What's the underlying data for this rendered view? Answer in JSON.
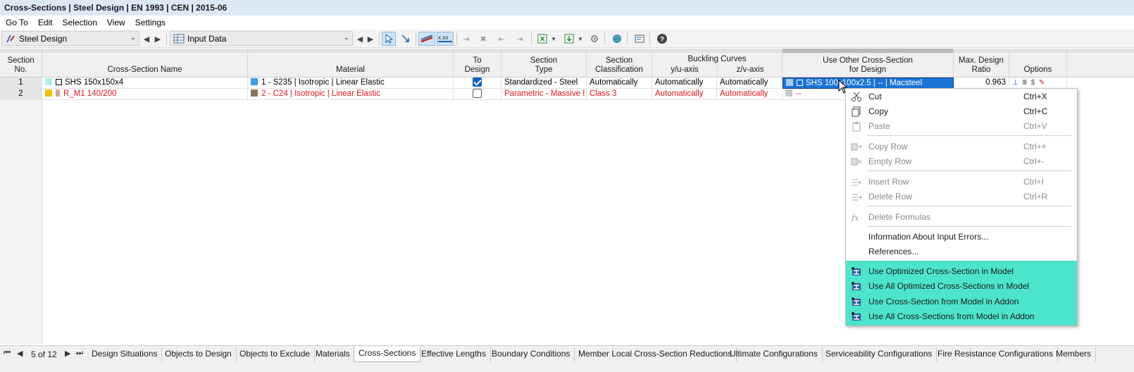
{
  "window": {
    "title": "Cross-Sections | Steel Design | EN 1993 | CEN | 2015-06"
  },
  "menu": [
    "Go To",
    "Edit",
    "Selection",
    "View",
    "Settings"
  ],
  "toolbar": {
    "module_combo": "Steel Design",
    "view_combo": "Input Data"
  },
  "columns": {
    "section_no": [
      "Section",
      "No."
    ],
    "cross_section_name": "Cross-Section Name",
    "material": "Material",
    "to_design": [
      "To",
      "Design"
    ],
    "section_type": [
      "Section",
      "Type"
    ],
    "section_classification": [
      "Section",
      "Classification"
    ],
    "buckling_curves": "Buckling Curves",
    "yu_axis": "y/u-axis",
    "zv_axis": "z/v-axis",
    "use_other": [
      "Use Other Cross-Section",
      "for Design"
    ],
    "max_ratio": [
      "Max. Design",
      "Ratio"
    ],
    "options": "Options"
  },
  "rows": [
    {
      "no": "1",
      "name": "SHS 150x150x4",
      "name_color": "#aaf0f0",
      "material": "1 - S235 | Isotropic | Linear Elastic",
      "material_color": "#3aa0e8",
      "to_design": true,
      "type": "Standardized - Steel",
      "classification": "Automatically",
      "yu": "Automatically",
      "zv": "Automatically",
      "use_other": "SHS 100x100x2.5 | -- | Macsteel",
      "max_ratio": "0.963",
      "error": false
    },
    {
      "no": "2",
      "name": "R_M1 140/200",
      "name_color": "#f2c200",
      "material": "2 - C24 | Isotropic | Linear Elastic",
      "material_color": "#8b7560",
      "to_design": false,
      "type": "Parametric - Massive I",
      "classification": "Class 3",
      "yu": "Automatically",
      "zv": "Automatically",
      "use_other": "--",
      "max_ratio": "",
      "error": true
    }
  ],
  "context_menu": {
    "items": [
      {
        "label": "Cut",
        "shortcut": "Ctrl+X",
        "icon": "cut-icon",
        "enabled": true
      },
      {
        "label": "Copy",
        "shortcut": "Ctrl+C",
        "icon": "copy-icon",
        "enabled": true
      },
      {
        "label": "Paste",
        "shortcut": "Ctrl+V",
        "icon": "paste-icon",
        "enabled": false
      },
      {
        "label": "Copy Row",
        "shortcut": "Ctrl++",
        "icon": "copy-row-icon",
        "enabled": false
      },
      {
        "label": "Empty Row",
        "shortcut": "Ctrl+-",
        "icon": "empty-row-icon",
        "enabled": false
      },
      {
        "label": "Insert Row",
        "shortcut": "Ctrl+I",
        "icon": "insert-row-icon",
        "enabled": false
      },
      {
        "label": "Delete Row",
        "shortcut": "Ctrl+R",
        "icon": "delete-row-icon",
        "enabled": false
      },
      {
        "label": "Delete Formulas",
        "shortcut": "",
        "icon": "formula-icon",
        "enabled": false
      },
      {
        "label": "Information About Input Errors...",
        "shortcut": "",
        "icon": "",
        "enabled": true
      },
      {
        "label": "References...",
        "shortcut": "",
        "icon": "",
        "enabled": true
      },
      {
        "label": "Use Optimized Cross-Section in Model",
        "shortcut": "",
        "icon": "cross-section-icon",
        "enabled": true
      },
      {
        "label": "Use All Optimized Cross-Sections in Model",
        "shortcut": "",
        "icon": "cross-section-icon",
        "enabled": true
      },
      {
        "label": "Use Cross-Section from Model in Addon",
        "shortcut": "",
        "icon": "cross-section-icon",
        "enabled": true
      },
      {
        "label": "Use All Cross-Sections from Model in Addon",
        "shortcut": "",
        "icon": "cross-section-icon",
        "enabled": true
      }
    ],
    "highlight_color": "#4ce5cc"
  },
  "pager": {
    "text": "5 of 12"
  },
  "tabs": [
    "Design Situations",
    "Objects to Design",
    "Objects to Exclude",
    "Materials",
    "Cross-Sections",
    "Effective Lengths",
    "Boundary Conditions",
    "Member Local Cross-Section Reductions",
    "Ultimate Configurations",
    "Serviceability Configurations",
    "Fire Resistance Configurations",
    "Members"
  ],
  "active_tab": "Cross-Sections",
  "colors": {
    "selection": "#1a74d6",
    "error_text": "#e0141e",
    "title_bg": "#dde8f5"
  }
}
